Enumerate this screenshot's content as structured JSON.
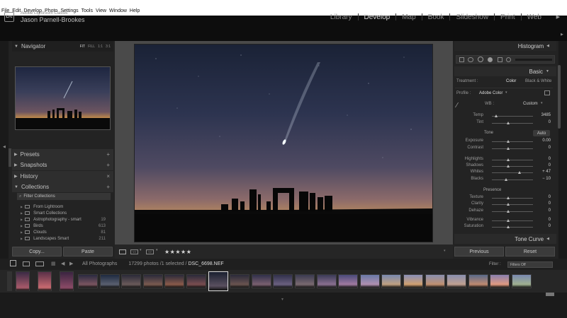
{
  "menubar": [
    "File",
    "Edit",
    "Develop",
    "Photo",
    "Settings",
    "Tools",
    "View",
    "Window",
    "Help"
  ],
  "identity": {
    "badge": "Lrc",
    "app": "Adobe Lightroom Classic",
    "user": "Jason Parnell-Brookes"
  },
  "modules": [
    {
      "label": "Library",
      "active": false
    },
    {
      "label": "Develop",
      "active": true
    },
    {
      "label": "Map",
      "active": false
    },
    {
      "label": "Book",
      "active": false
    },
    {
      "label": "Slideshow",
      "active": false
    },
    {
      "label": "Print",
      "active": false
    },
    {
      "label": "Web",
      "active": false
    }
  ],
  "navigator": {
    "title": "Navigator",
    "options": [
      "FIT",
      "FILL",
      "1:1",
      "3:1"
    ]
  },
  "left_panels": {
    "presets": "Presets",
    "snapshots": "Snapshots",
    "history": "History",
    "collections": "Collections"
  },
  "filter_collections": "Filter Collections",
  "collections": [
    {
      "name": "From Lightroom",
      "count": ""
    },
    {
      "name": "Smart Collections",
      "count": ""
    },
    {
      "name": "Astrophotography - smart",
      "count": "19"
    },
    {
      "name": "Birds",
      "count": "613"
    },
    {
      "name": "Clouds",
      "count": "81"
    },
    {
      "name": "Landscapes Smart",
      "count": "211"
    }
  ],
  "left_buttons": {
    "copy": "Copy...",
    "paste": "Paste"
  },
  "toolbar": {
    "rating": "★★★★★"
  },
  "right": {
    "histogram": "Histogram",
    "basic": "Basic",
    "treatment_label": "Treatment :",
    "treatment_color": "Color",
    "treatment_bw": "Black & White",
    "profile_label": "Profile :",
    "profile_value": "Adobe Color",
    "wb_label": "WB :",
    "wb_value": "Custom",
    "tone_label": "Tone",
    "auto_label": "Auto",
    "presence_label": "Presence",
    "tone_curve": "Tone Curve",
    "previous": "Previous",
    "reset": "Reset"
  },
  "sliders": [
    {
      "label": "Temp",
      "value": "3485",
      "pos": 0.1
    },
    {
      "label": "Tint",
      "value": "0",
      "pos": 0.4
    },
    {
      "label": "Exposure",
      "value": "0.00",
      "pos": 0.4
    },
    {
      "label": "Contrast",
      "value": "0",
      "pos": 0.4
    },
    {
      "label": "Highlights",
      "value": "0",
      "pos": 0.4
    },
    {
      "label": "Shadows",
      "value": "0",
      "pos": 0.4
    },
    {
      "label": "Whites",
      "value": "+ 47",
      "pos": 0.68
    },
    {
      "label": "Blacks",
      "value": "− 10",
      "pos": 0.34
    },
    {
      "label": "Texture",
      "value": "0",
      "pos": 0.4
    },
    {
      "label": "Clarity",
      "value": "0",
      "pos": 0.4
    },
    {
      "label": "Dehaze",
      "value": "0",
      "pos": 0.4
    },
    {
      "label": "Vibrance",
      "value": "0",
      "pos": 0.4
    },
    {
      "label": "Saturation",
      "value": "0",
      "pos": 0.4
    }
  ],
  "filmstrip": {
    "source": "All Photographs",
    "info": "17299 photos /1 selected /",
    "file": "DSC_6698.NEF",
    "filter_label": "Filter :",
    "filter_value": "Filters Off"
  },
  "colors": {
    "accent_active": "#dcdcdc",
    "panel_bg": "#232323",
    "center_bg": "#4a4a4a"
  }
}
